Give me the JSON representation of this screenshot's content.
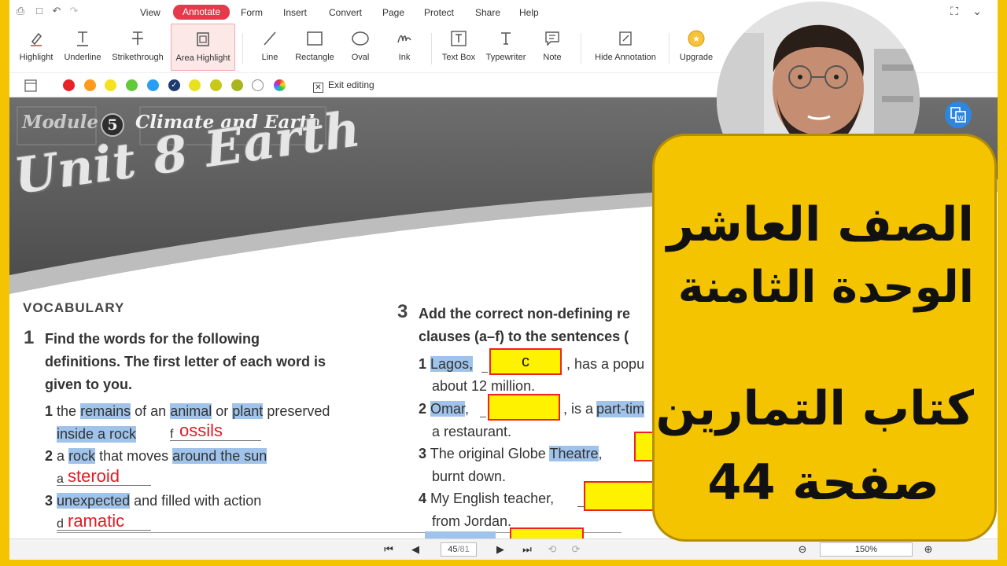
{
  "menu": {
    "items": [
      "View",
      "Annotate",
      "Form",
      "Insert",
      "Convert",
      "Page",
      "Protect",
      "Share",
      "Help"
    ],
    "active": "Annotate"
  },
  "toolbar": {
    "tools": [
      {
        "label": "Highlight",
        "icon": "highlighter-icon"
      },
      {
        "label": "Underline",
        "icon": "underline-icon"
      },
      {
        "label": "Strikethrough",
        "icon": "strikethrough-icon"
      },
      {
        "label": "Area Highlight",
        "icon": "area-highlight-icon",
        "selected": true
      },
      {
        "label": "Line",
        "icon": "line-icon"
      },
      {
        "label": "Rectangle",
        "icon": "rectangle-icon"
      },
      {
        "label": "Oval",
        "icon": "oval-icon"
      },
      {
        "label": "Ink",
        "icon": "ink-icon"
      },
      {
        "label": "Text Box",
        "icon": "text-box-icon"
      },
      {
        "label": "Typewriter",
        "icon": "typewriter-icon"
      },
      {
        "label": "Note",
        "icon": "note-icon"
      },
      {
        "label": "Hide Annotation",
        "icon": "hide-annotation-icon"
      },
      {
        "label": "Upgrade",
        "icon": "upgrade-icon"
      }
    ]
  },
  "colorbar": {
    "swatches": [
      "#e8222a",
      "#ff9a1a",
      "#f3e21d",
      "#64c83c",
      "#2a9df4",
      "#1f3a6e",
      "#e8e21e",
      "#c8c81a",
      "#a8b51e",
      "#ffffff"
    ],
    "selected_index": 5,
    "exit_label": "Exit editing"
  },
  "document": {
    "module_label": "Module",
    "module_number": "5",
    "module_title": "Climate and Earth",
    "unit_title": "Unit 8 Earth",
    "section_heading": "VOCABULARY",
    "ex1": {
      "number": "1",
      "instruction": [
        "Find the words for the following",
        "definitions. The first letter of each word is",
        "given to you."
      ],
      "items": [
        {
          "num": "1",
          "parts": [
            "the",
            "remains",
            "of an",
            "animal",
            "or",
            "plant",
            "preserved"
          ],
          "line2": "inside a rock",
          "letter": "f",
          "answer": "ossils"
        },
        {
          "num": "2",
          "parts": [
            "a",
            "rock",
            "that moves",
            "around the sun"
          ],
          "letter": "a",
          "answer": "steroid"
        },
        {
          "num": "3",
          "parts": [
            "unexpected",
            "and filled with action"
          ],
          "letter": "d",
          "answer": "ramatic"
        }
      ]
    },
    "ex3": {
      "number": "3",
      "instruction": [
        "Add the correct non-defining re",
        "clauses (a–f) to the sentences ("
      ],
      "items": [
        {
          "num": "1",
          "subject": "Lagos,",
          "answer": "c",
          "rest": ", has a popu",
          "line2": "about 12 million."
        },
        {
          "num": "2",
          "subject": "Omar",
          "comma": ",",
          "rest": ", is a",
          "rest_hl": "part-tim",
          "line2": "a restaurant."
        },
        {
          "num": "3",
          "pre": "The original Globe",
          "subject": "Theatre",
          "rest": ",",
          "line2": "burnt down."
        },
        {
          "num": "4",
          "pre": "My English teacher,",
          "line2": "from Jordan."
        }
      ]
    }
  },
  "status": {
    "page_current": "45",
    "page_total": "/81",
    "zoom": "150%"
  },
  "overlay": {
    "lines": [
      "الصف العاشر",
      "الوحدة الثامنة",
      "كتاب التمارين",
      "صفحة 44"
    ]
  }
}
